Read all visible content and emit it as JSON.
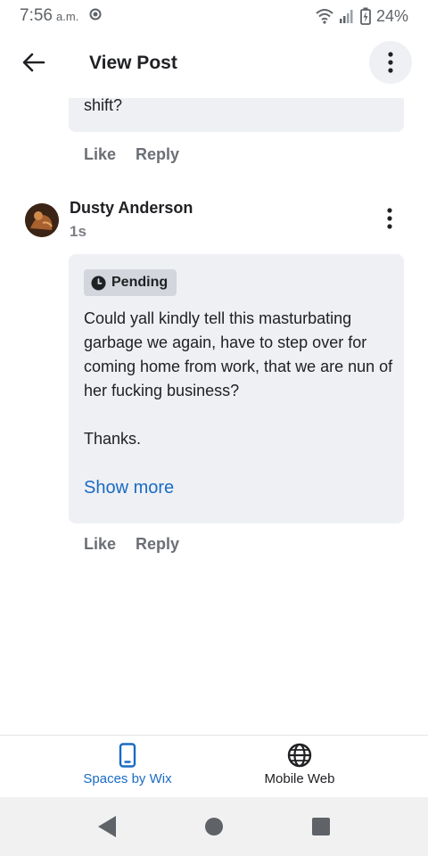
{
  "status_bar": {
    "time": "7:56",
    "ampm": "a.m.",
    "battery": "24%"
  },
  "header": {
    "title": "View Post"
  },
  "previous_comment": {
    "tail_text": "shift?",
    "like_label": "Like",
    "reply_label": "Reply"
  },
  "comment": {
    "author": "Dusty Anderson",
    "time": "1s",
    "status_badge": "Pending",
    "paragraphs": [
      "Could yall kindly tell this masturbating garbage we again, have to step over for coming home from work, that we are nun of her fucking business?",
      "Thanks."
    ],
    "show_more_label": "Show more",
    "like_label": "Like",
    "reply_label": "Reply"
  },
  "bottom_nav": {
    "items": [
      {
        "label": "Spaces by Wix",
        "icon": "phone-icon",
        "active": true
      },
      {
        "label": "Mobile Web",
        "icon": "globe-icon",
        "active": false
      }
    ]
  },
  "colors": {
    "accent": "#1a6bc4",
    "bubble_bg": "#eef0f4",
    "muted_text": "#6b6f75"
  }
}
